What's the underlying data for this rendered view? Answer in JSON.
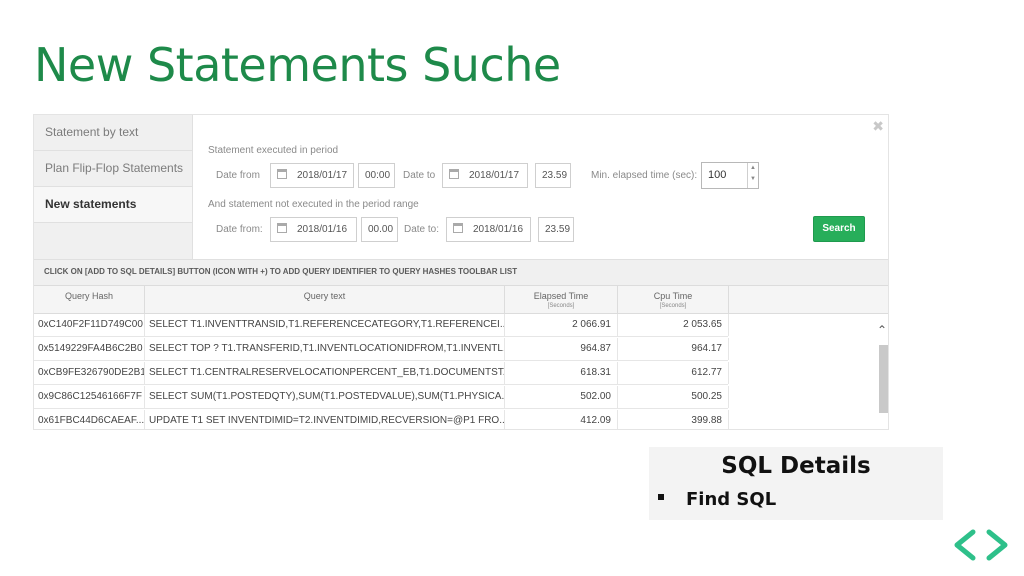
{
  "slide": {
    "title": "New Statements Suche"
  },
  "sidebar": {
    "items": [
      {
        "label": "Statement by text"
      },
      {
        "label": "Plan Flip-Flop Statements"
      },
      {
        "label": "New statements"
      }
    ]
  },
  "form": {
    "close_icon": "close-icon",
    "section1_label": "Statement executed in period",
    "date_from_label": "Date from",
    "date_from_value": "2018/01/17",
    "time_from_value": "00:00",
    "date_to_label": "Date to",
    "date_to_value": "2018/01/17",
    "time_to_value": "23.59",
    "min_elapsed_label": "Min. elapsed time (sec):",
    "min_elapsed_value": "100",
    "section2_label": "And statement not executed in the period range",
    "date_from2_label": "Date from:",
    "date_from2_value": "2018/01/16",
    "time_from2_value": "00.00",
    "date_to2_label": "Date to:",
    "date_to2_value": "2018/01/16",
    "time_to2_value": "23.59",
    "search_label": "Search"
  },
  "info_text": "CLICK ON [ADD TO SQL DETAILS] BUTTON (ICON WITH +) TO ADD QUERY IDENTIFIER TO QUERY HASHES TOOLBAR LIST",
  "table": {
    "columns": [
      {
        "label": "Query Hash",
        "sub": ""
      },
      {
        "label": "Query text",
        "sub": ""
      },
      {
        "label": "Elapsed Time",
        "sub": "[Seconds]"
      },
      {
        "label": "Cpu Time",
        "sub": "[Seconds]"
      }
    ],
    "rows": [
      {
        "hash": "0xC140F2F11D749C00",
        "text": "SELECT T1.INVENTTRANSID,T1.REFERENCECATEGORY,T1.REFERENCEI...",
        "elapsed": "2 066.91",
        "cpu": "2 053.65"
      },
      {
        "hash": "0x5149229FA4B6C2B0",
        "text": "SELECT TOP ? T1.TRANSFERID,T1.INVENTLOCATIONIDFROM,T1.INVENTL...",
        "elapsed": "964.87",
        "cpu": "964.17"
      },
      {
        "hash": "0xCB9FE326790DE2B1",
        "text": "SELECT T1.CENTRALRESERVELOCATIONPERCENT_EB,T1.DOCUMENTST...",
        "elapsed": "618.31",
        "cpu": "612.77"
      },
      {
        "hash": "0x9C86C12546166F7F",
        "text": "SELECT SUM(T1.POSTEDQTY),SUM(T1.POSTEDVALUE),SUM(T1.PHYSICA...",
        "elapsed": "502.00",
        "cpu": "500.25"
      },
      {
        "hash": "0x61FBC44D6CAEAF...",
        "text": "UPDATE T1 SET INVENTDIMID=T2.INVENTDIMID,RECVERSION=@P1 FRO...",
        "elapsed": "412.09",
        "cpu": "399.88"
      }
    ]
  },
  "card": {
    "title": "SQL Details",
    "items": [
      {
        "label": "Find SQL"
      }
    ]
  },
  "colors": {
    "title_green": "#1e8a4a",
    "button_green": "#27ae5a",
    "logo_green": "#2ec08a"
  }
}
